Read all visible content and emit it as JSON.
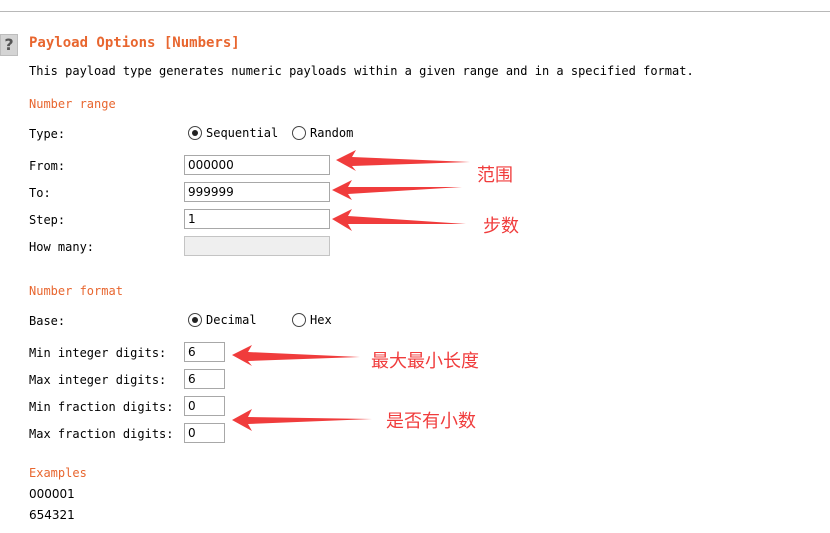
{
  "help_icon": "?",
  "title": "Payload Options [Numbers]",
  "description": "This payload type generates numeric payloads within a given range and in a specified format.",
  "number_range": {
    "heading": "Number range",
    "type_label": "Type:",
    "type_options": [
      "Sequential",
      "Random"
    ],
    "type_selected": "Sequential",
    "from_label": "From:",
    "from_value": "000000",
    "to_label": "To:",
    "to_value": "999999",
    "step_label": "Step:",
    "step_value": "1",
    "how_many_label": "How many:",
    "how_many_value": ""
  },
  "number_format": {
    "heading": "Number format",
    "base_label": "Base:",
    "base_options": [
      "Decimal",
      "Hex"
    ],
    "base_selected": "Decimal",
    "min_int_label": "Min integer digits:",
    "min_int_value": "6",
    "max_int_label": "Max integer digits:",
    "max_int_value": "6",
    "min_frac_label": "Min fraction digits:",
    "min_frac_value": "0",
    "max_frac_label": "Max fraction digits:",
    "max_frac_value": "0"
  },
  "examples": {
    "heading": "Examples",
    "values": [
      "000001",
      "654321"
    ]
  },
  "annotations": {
    "range_note": "范围",
    "step_note": "步数",
    "minmax_note": "最大最小长度",
    "decimal_note": "是否有小数",
    "color": "#f03c3c"
  },
  "accent_color": "#e8662f"
}
